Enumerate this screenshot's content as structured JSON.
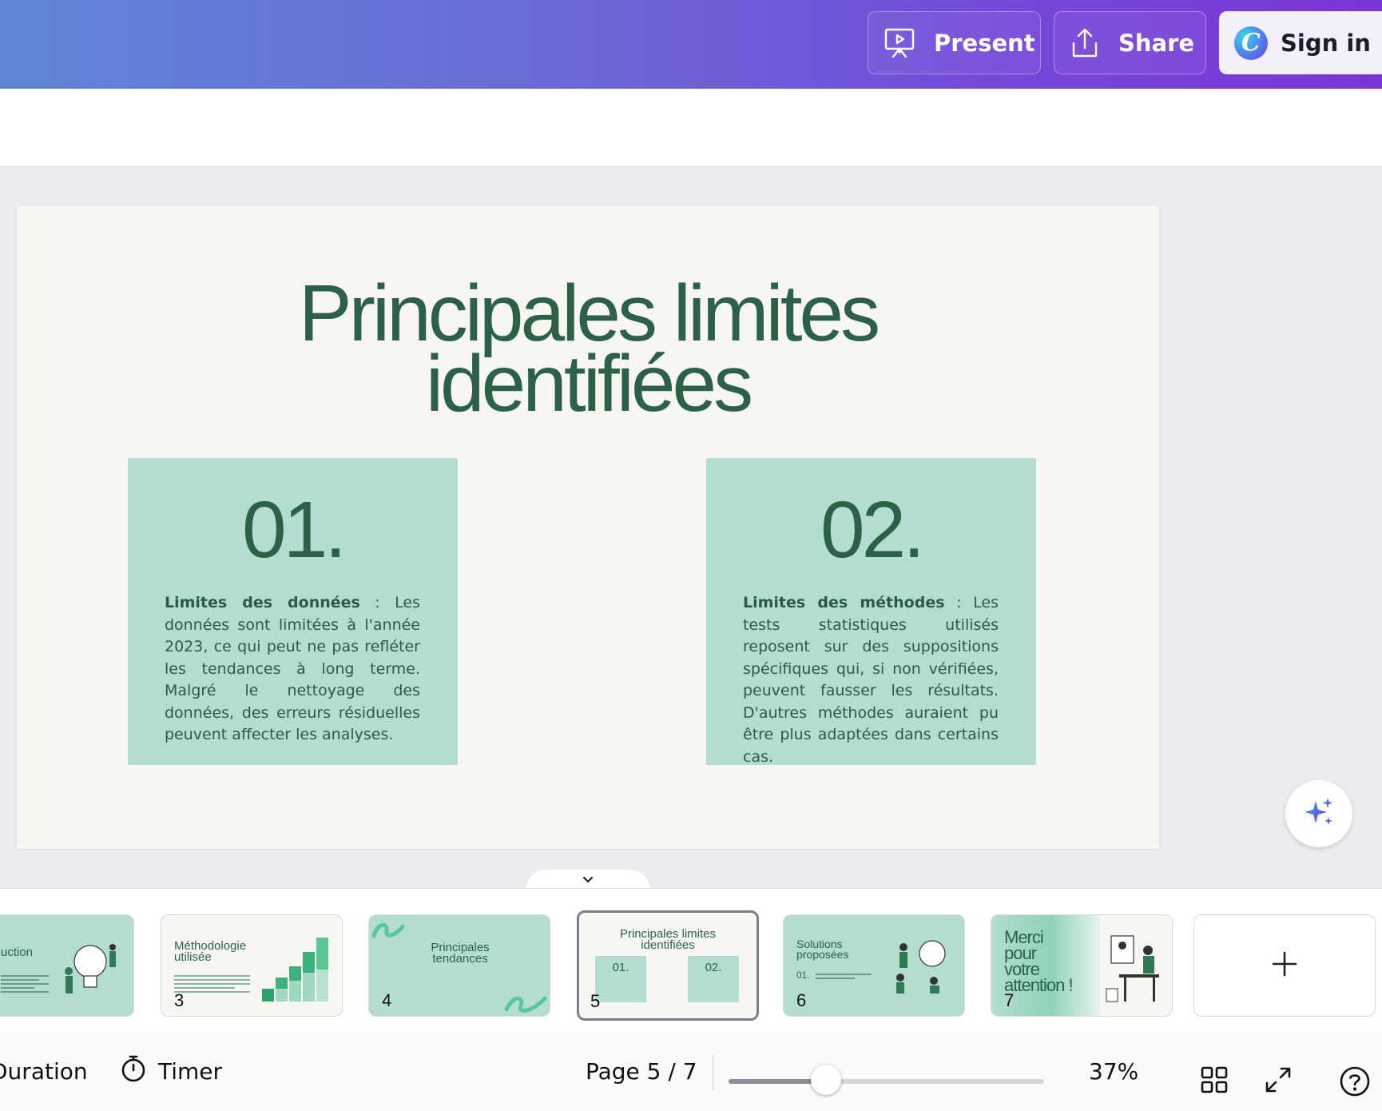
{
  "topbar": {
    "present_label": "Present",
    "share_label": "Share",
    "signin_label": "Sign in",
    "logo_letter": "C",
    "icons": [
      "presentation-screen-icon",
      "upload-share-icon",
      "canva-logo-icon"
    ]
  },
  "slide": {
    "title_line1": "Principales limites",
    "title_line2": "identifiées",
    "cards": [
      {
        "number": "01.",
        "bold": "Limites des données",
        "text": " : Les données sont limitées à l'année 2023, ce qui peut ne pas refléter les tendances à long terme. Malgré le nettoyage des données, des erreurs résiduelles peuvent affecter les analyses."
      },
      {
        "number": "02.",
        "bold": "Limites des méthodes",
        "text": " : Les tests statistiques utilisés reposent sur des suppositions spécifiques qui, si non vérifiées, peuvent fausser les résultats. D'autres méthodes auraient pu être plus adaptées dans certains cas."
      }
    ]
  },
  "filmstrip": {
    "thumbs": [
      {
        "num": "",
        "title": "uction"
      },
      {
        "num": "3",
        "title_l1": "Méthodologie",
        "title_l2": "utilisée"
      },
      {
        "num": "4",
        "title_l1": "Principales",
        "title_l2": "tendances"
      },
      {
        "num": "5",
        "title_l1": "Principales limites",
        "title_l2": "identifiées",
        "a": "01.",
        "b": "02."
      },
      {
        "num": "6",
        "title_l1": "Solutions",
        "title_l2": "proposées",
        "a": "01."
      },
      {
        "num": "7",
        "l1": "Merci",
        "l2": "pour",
        "l3": "votre",
        "l4": "attention !"
      }
    ],
    "add_label": "+"
  },
  "bottombar": {
    "duration_label": "Duration",
    "timer_label": "Timer",
    "page_label": "Page 5 / 7",
    "zoom_label": "37%",
    "zoom_level": 0.31
  },
  "colors": {
    "accent_green": "#2b6147",
    "card_mint": "#b3ddd1",
    "slide_bg": "#f8f6f2",
    "header_gradient_start": "#5f86d6",
    "header_gradient_end": "#7a36d6"
  }
}
